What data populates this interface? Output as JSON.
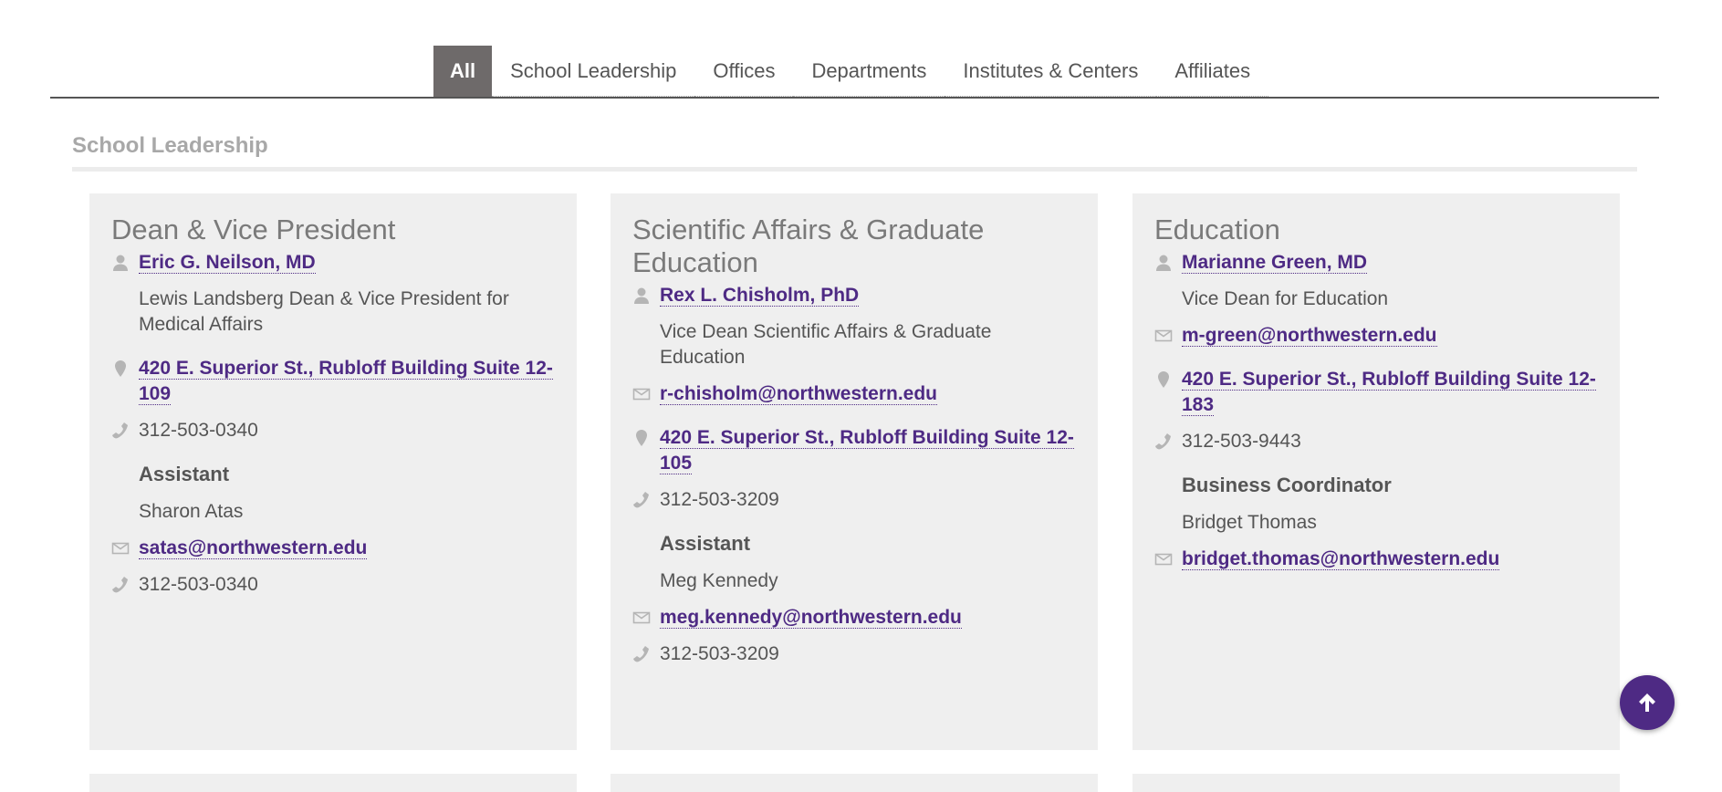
{
  "tabs": [
    {
      "label": "All",
      "active": true
    },
    {
      "label": "School Leadership",
      "active": false
    },
    {
      "label": "Offices",
      "active": false
    },
    {
      "label": "Departments",
      "active": false
    },
    {
      "label": "Institutes & Centers",
      "active": false
    },
    {
      "label": "Affiliates",
      "active": false
    }
  ],
  "section_title": "School Leadership",
  "cards": [
    {
      "title": "Dean & Vice President",
      "name": "Eric G. Neilson, MD",
      "role": "Lewis Landsberg Dean & Vice President for Medical Affairs",
      "address": "420 E. Superior St., Rubloff Building Suite 12-109",
      "phone": "312-503-0340",
      "assistant_label": "Assistant",
      "assistant_name": "Sharon Atas",
      "assistant_email": "satas@northwestern.edu",
      "assistant_phone": "312-503-0340"
    },
    {
      "title": "Scientific Affairs & Graduate Education",
      "name": "Rex L. Chisholm, PhD",
      "role": "Vice Dean Scientific Affairs & Graduate Education",
      "email": "r-chisholm@northwestern.edu",
      "address": "420 E. Superior St., Rubloff Building Suite 12-105",
      "phone": "312-503-3209",
      "assistant_label": "Assistant",
      "assistant_name": "Meg Kennedy",
      "assistant_email": "meg.kennedy@northwestern.edu",
      "assistant_phone": "312-503-3209"
    },
    {
      "title": "Education",
      "name": "Marianne Green, MD",
      "role": "Vice Dean for Education",
      "email": "m-green@northwestern.edu",
      "address": "420 E. Superior St., Rubloff Building Suite 12-183",
      "phone": "312-503-9443",
      "assistant_label": "Business Coordinator",
      "assistant_name": "Bridget Thomas",
      "assistant_email": "bridget.thomas@northwestern.edu"
    }
  ],
  "icons": {
    "person": "person-icon",
    "email": "envelope-icon",
    "location": "map-pin-icon",
    "phone": "phone-icon",
    "back_to_top": "arrow-up-icon"
  },
  "colors": {
    "brand_purple": "#4e2a84",
    "active_tab": "#6e6a6a",
    "card_bg": "#efefef",
    "muted_title": "#a8a8a8"
  }
}
